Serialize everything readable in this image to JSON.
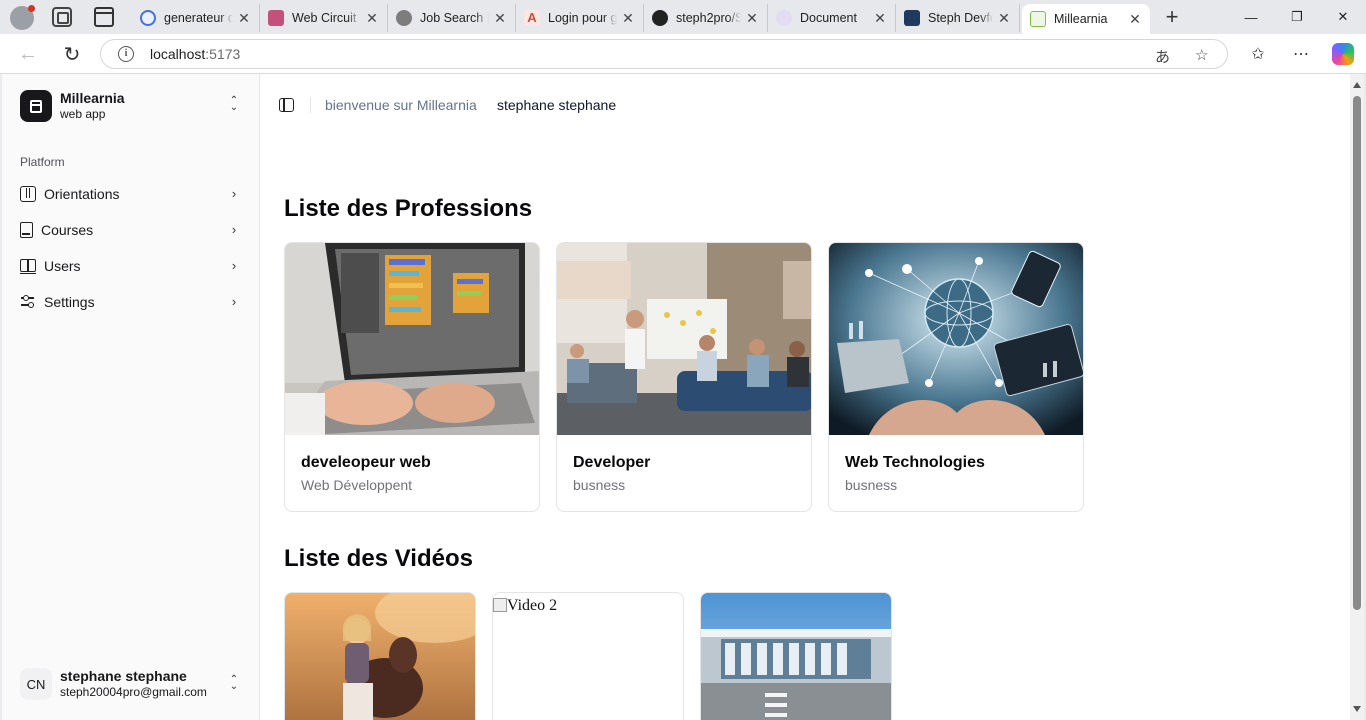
{
  "browser": {
    "tabs": [
      {
        "label": "generateur d",
        "fav_color": "#4a6fd6"
      },
      {
        "label": "Web Circuit",
        "fav_color": "#c2527a"
      },
      {
        "label": "Job Search |",
        "fav_color": "#7d7d7d"
      },
      {
        "label": "Login pour g",
        "fav_color": "#c94f3c"
      },
      {
        "label": "steph2pro/S",
        "fav_color": "#222222"
      },
      {
        "label": "Document",
        "fav_color": "#8e7cc3"
      },
      {
        "label": "Steph Devfo",
        "fav_color": "#1e3a5f"
      },
      {
        "label": "Millearnia",
        "fav_color": "#7ac142"
      }
    ],
    "active_tab_index": 7,
    "url_host": "localhost",
    "url_port": ":5173",
    "new_tab_glyph": "+",
    "window_controls": [
      "—",
      "❐",
      "✕"
    ]
  },
  "sidebar": {
    "brand_name": "Millearnia",
    "brand_sub": "web app",
    "group_label": "Platform",
    "items": [
      {
        "label": "Orientations",
        "icon": "compass-icon"
      },
      {
        "label": "Courses",
        "icon": "book-icon"
      },
      {
        "label": "Users",
        "icon": "open-book-icon"
      },
      {
        "label": "Settings",
        "icon": "sliders-icon"
      }
    ],
    "user": {
      "initials": "CN",
      "name": "stephane stephane",
      "email": "steph20004pro@gmail.com"
    }
  },
  "header": {
    "breadcrumb_prefix": "bienvenue sur Millearnia",
    "breadcrumb_user": "stephane stephane"
  },
  "professions": {
    "title": "Liste des Professions",
    "cards": [
      {
        "title": "develeopeur web",
        "subtitle": "Web Développent",
        "image": "laptop-coding-photo"
      },
      {
        "title": "Developer",
        "subtitle": "busness",
        "image": "team-meeting-photo"
      },
      {
        "title": "Web Technologies",
        "subtitle": "busness",
        "image": "global-network-photo"
      }
    ]
  },
  "videos": {
    "title": "Liste des Vidéos",
    "items": [
      {
        "alt": "",
        "image": "girl-with-pony-photo"
      },
      {
        "alt": "Video 2",
        "image": "broken-image"
      },
      {
        "alt": "",
        "image": "modern-building-photo"
      }
    ]
  },
  "colors": {
    "sidebar_bg": "#fafafa",
    "text_primary": "#09090b",
    "text_muted": "#71717a",
    "breadcrumb_muted": "#64748b",
    "border": "#e4e4e7"
  }
}
